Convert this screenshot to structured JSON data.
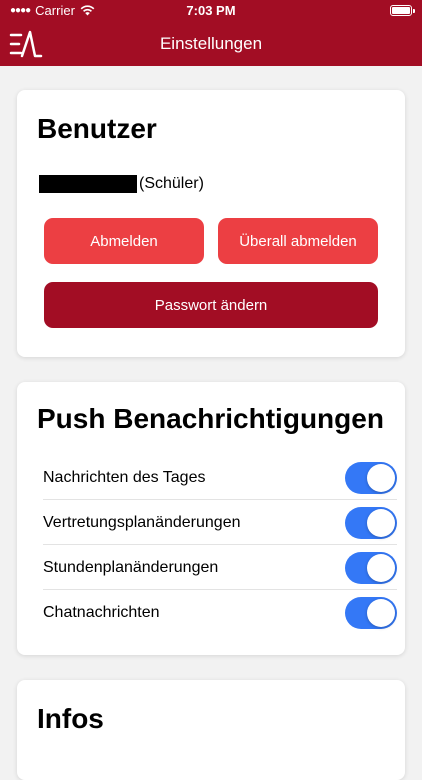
{
  "status_bar": {
    "carrier": "Carrier",
    "time": "7:03 PM"
  },
  "nav": {
    "title": "Einstellungen",
    "logo_icon": "app-logo-icon"
  },
  "user_section": {
    "title": "Benutzer",
    "role": "(Schüler)",
    "buttons": {
      "logout": "Abmelden",
      "logout_everywhere": "Überall abmelden",
      "change_password": "Passwort ändern"
    }
  },
  "push_section": {
    "title": "Push Benachrichtigungen",
    "items": [
      {
        "label": "Nachrichten des Tages",
        "enabled": true
      },
      {
        "label": "Vertretungsplanänderungen",
        "enabled": true
      },
      {
        "label": "Stundenplanänderungen",
        "enabled": true
      },
      {
        "label": "Chatnachrichten",
        "enabled": true
      }
    ]
  },
  "info_section": {
    "title": "Infos"
  },
  "colors": {
    "brand": "#a20d24",
    "button_light": "#ec3f43",
    "toggle_on": "#3478f6"
  }
}
